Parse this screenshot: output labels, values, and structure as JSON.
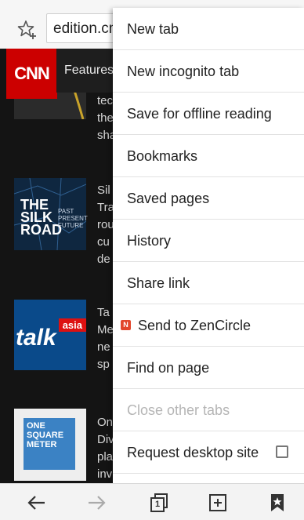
{
  "address_bar": {
    "url_text": "edition.cnn.com",
    "bookmark_icon": "star-add-icon"
  },
  "page": {
    "logo_text": "CNN",
    "nav_item": "Features",
    "article_fragments": [
      "tec\nthe\nsha",
      "Sil\nTra\nrou\ncu\nde",
      "Ta\nMe\nne\nsp",
      "On\nDiv\npla\ninv"
    ],
    "thumb_silk_road_title": "THE\nSILK\nROAD",
    "thumb_silk_road_sub": "PAST\nPRESENT\nFUTURE",
    "thumb_talk": "talk",
    "thumb_talk_tag": "asia",
    "thumb_one_square_meter": "ONE\nSQUARE\nMETER"
  },
  "menu": {
    "items": [
      {
        "label": "New tab",
        "enabled": true
      },
      {
        "label": "New incognito tab",
        "enabled": true
      },
      {
        "label": "Save for offline reading",
        "enabled": true
      },
      {
        "label": "Bookmarks",
        "enabled": true
      },
      {
        "label": "Saved pages",
        "enabled": true
      },
      {
        "label": "History",
        "enabled": true
      },
      {
        "label": "Share link",
        "enabled": true
      },
      {
        "label": "Send to ZenCircle",
        "enabled": true,
        "icon": "zencircle-icon",
        "badge": "N"
      },
      {
        "label": "Find on page",
        "enabled": true
      },
      {
        "label": "Close other tabs",
        "enabled": false
      },
      {
        "label": "Request desktop site",
        "enabled": true,
        "checkbox": false
      }
    ]
  },
  "bottom_bar": {
    "icons": [
      "back-arrow-icon",
      "forward-arrow-icon",
      "tabs-icon",
      "new-tab-icon",
      "bookmark-icon"
    ],
    "tab_count": "1",
    "forward_enabled": false
  },
  "colors": {
    "cnn_red": "#cc0000",
    "menu_bg": "#ffffff",
    "disabled_text": "#b5b5b5",
    "zencircle_badge": "#e2462b"
  }
}
